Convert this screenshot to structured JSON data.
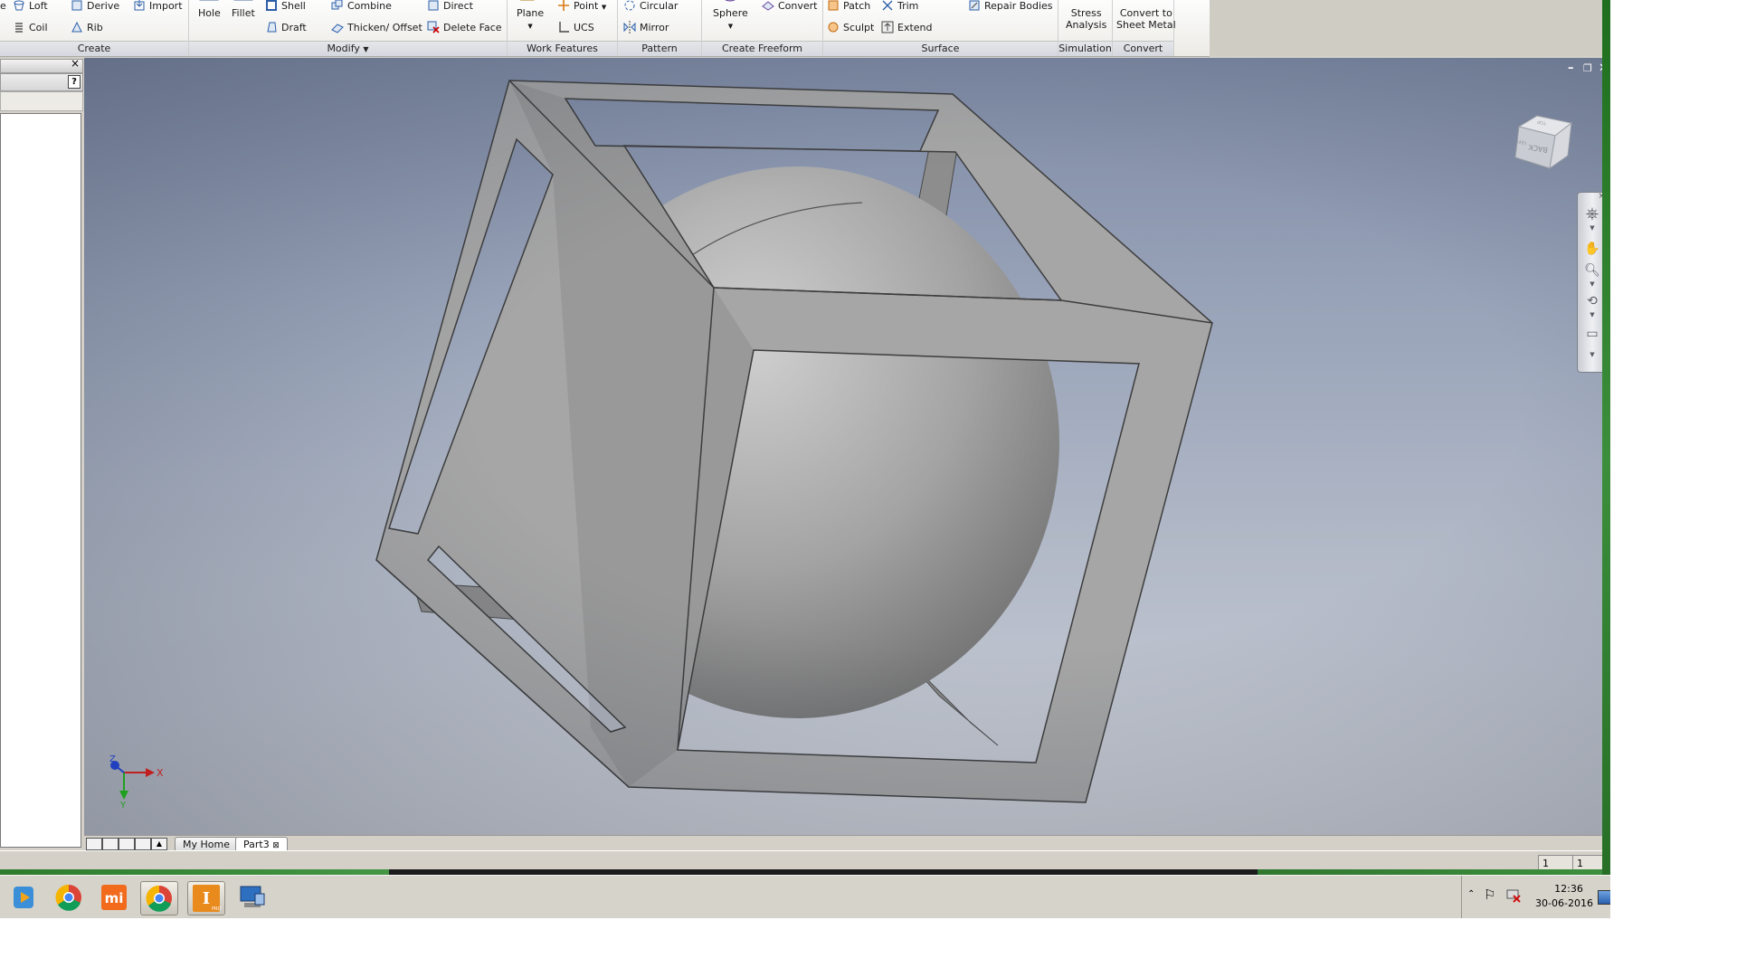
{
  "ribbon": {
    "create": {
      "title": "Create",
      "loft": "Loft",
      "coil": "Coil",
      "derive": "Derive",
      "rib": "Rib",
      "import": "Import",
      "e": "e"
    },
    "modify": {
      "title": "Modify",
      "hole": "Hole",
      "fillet": "Fillet",
      "shell": "Shell",
      "draft": "Draft",
      "combine": "Combine",
      "thicken": "Thicken/ Offset",
      "direct": "Direct",
      "delete_face": "Delete Face"
    },
    "work_features": {
      "title": "Work Features",
      "plane": "Plane",
      "point": "Point",
      "ucs": "UCS"
    },
    "pattern": {
      "title": "Pattern",
      "circular": "Circular",
      "mirror": "Mirror"
    },
    "freeform": {
      "title": "Create Freeform",
      "sphere": "Sphere",
      "convert": "Convert"
    },
    "surface": {
      "title": "Surface",
      "patch": "Patch",
      "sculpt": "Sculpt",
      "trim": "Trim",
      "extend": "Extend",
      "repair": "Repair Bodies"
    },
    "simulation": {
      "title": "Simulation",
      "stress_line1": "Stress",
      "stress_line2": "Analysis"
    },
    "convert": {
      "title": "Convert",
      "sheet_line1": "Convert to",
      "sheet_line2": "Sheet Metal"
    }
  },
  "browser": {
    "help": "?",
    "close": "×"
  },
  "viewport": {
    "window_controls": {
      "minimize": "–",
      "restore": "❐",
      "close": "✕"
    },
    "viewcube": {
      "face_label": "BACK",
      "side_label": "LEFT",
      "top_label": "TOP"
    },
    "axes": {
      "x": "X",
      "y": "Y",
      "z": "Z"
    }
  },
  "doc_tabs": [
    {
      "label": "My Home"
    },
    {
      "label": "Part3",
      "close": "⊠"
    }
  ],
  "status": {
    "box1": "1",
    "box2": "1"
  },
  "taskbar": {
    "clock_time": "12:36",
    "clock_date": "30-06-2016",
    "inventor_badge": "I",
    "inventor_sub": "PRO",
    "mi_label": "mi"
  },
  "colors": {
    "accent": "#e88a1c",
    "viewport_top": "#7e8aa4",
    "viewport_bottom": "#cbced5",
    "model": "#9e9e9e"
  }
}
